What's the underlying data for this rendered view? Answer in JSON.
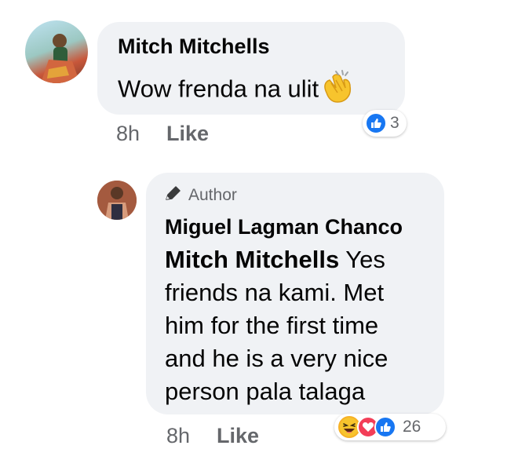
{
  "comment": {
    "author": "Mitch Mitchells",
    "text": "Wow frenda na ulit",
    "emoji_icon": "clapping-hands-icon",
    "time": "8h",
    "like_label": "Like",
    "reaction_count": "3",
    "reaction_icons": [
      "like-icon"
    ]
  },
  "reply": {
    "badge_label": "Author",
    "badge_icon": "pencil-icon",
    "author": "Miguel Lagman Chanco",
    "mention": "Mitch Mitchells",
    "text_lines": [
      " Yes",
      "friends na kami. Met",
      "him for the first time",
      "and he is a very nice",
      "person pala talaga"
    ],
    "time": "8h",
    "like_label": "Like",
    "reaction_count": "26",
    "reaction_icons": [
      "haha-icon",
      "love-icon",
      "like-icon"
    ]
  },
  "colors": {
    "bubble": "#f0f2f5",
    "like_blue": "#1877f2",
    "love_red": "#f33e58",
    "haha_yellow": "#f7b125",
    "meta_gray": "#65676b"
  }
}
